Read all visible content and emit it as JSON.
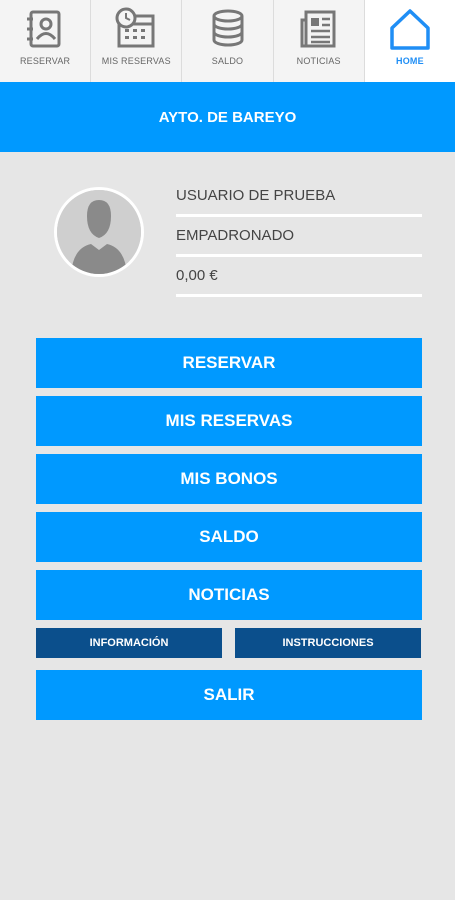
{
  "tabs": [
    {
      "label": "RESERVAR",
      "icon": "address-book-icon"
    },
    {
      "label": "MIS RESERVAS",
      "icon": "calendar-clock-icon"
    },
    {
      "label": "SALDO",
      "icon": "coins-icon"
    },
    {
      "label": "NOTICIAS",
      "icon": "newspaper-icon"
    },
    {
      "label": "HOME",
      "icon": "home-icon",
      "active": true
    }
  ],
  "header": {
    "title": "AYTO. DE BAREYO"
  },
  "profile": {
    "name": "USUARIO DE PRUEBA",
    "status": "EMPADRONADO",
    "balance": "0,00 €"
  },
  "menu": {
    "reservar": "RESERVAR",
    "mis_reservas": "MIS RESERVAS",
    "mis_bonos": "MIS BONOS",
    "saldo": "SALDO",
    "noticias": "NOTICIAS",
    "informacion": "INFORMACIÓN",
    "instrucciones": "INSTRUCCIONES",
    "salir": "SALIR"
  },
  "colors": {
    "accent": "#0099ff",
    "dark_button": "#0b4f8c",
    "background": "#e6e6e6"
  }
}
